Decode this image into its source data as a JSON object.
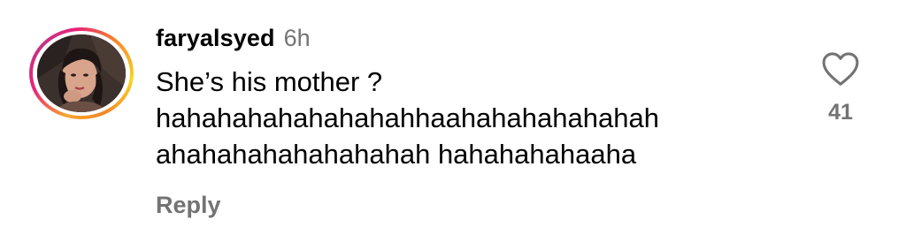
{
  "comment": {
    "username": "faryalsyed",
    "timestamp": "6h",
    "text": "She’s his mother ?\nhahahahahahahahahhaahahahahahahah\nahahahahahahahahah hahahahahaaha",
    "reply_label": "Reply",
    "like_count": "41"
  },
  "icons": {
    "like": "heart-outline-icon",
    "avatar": "profile-photo"
  },
  "colors": {
    "text": "#000000",
    "secondary": "#737373",
    "story_ring": [
      "#f9a52b",
      "#e9247a",
      "#c13584"
    ]
  }
}
